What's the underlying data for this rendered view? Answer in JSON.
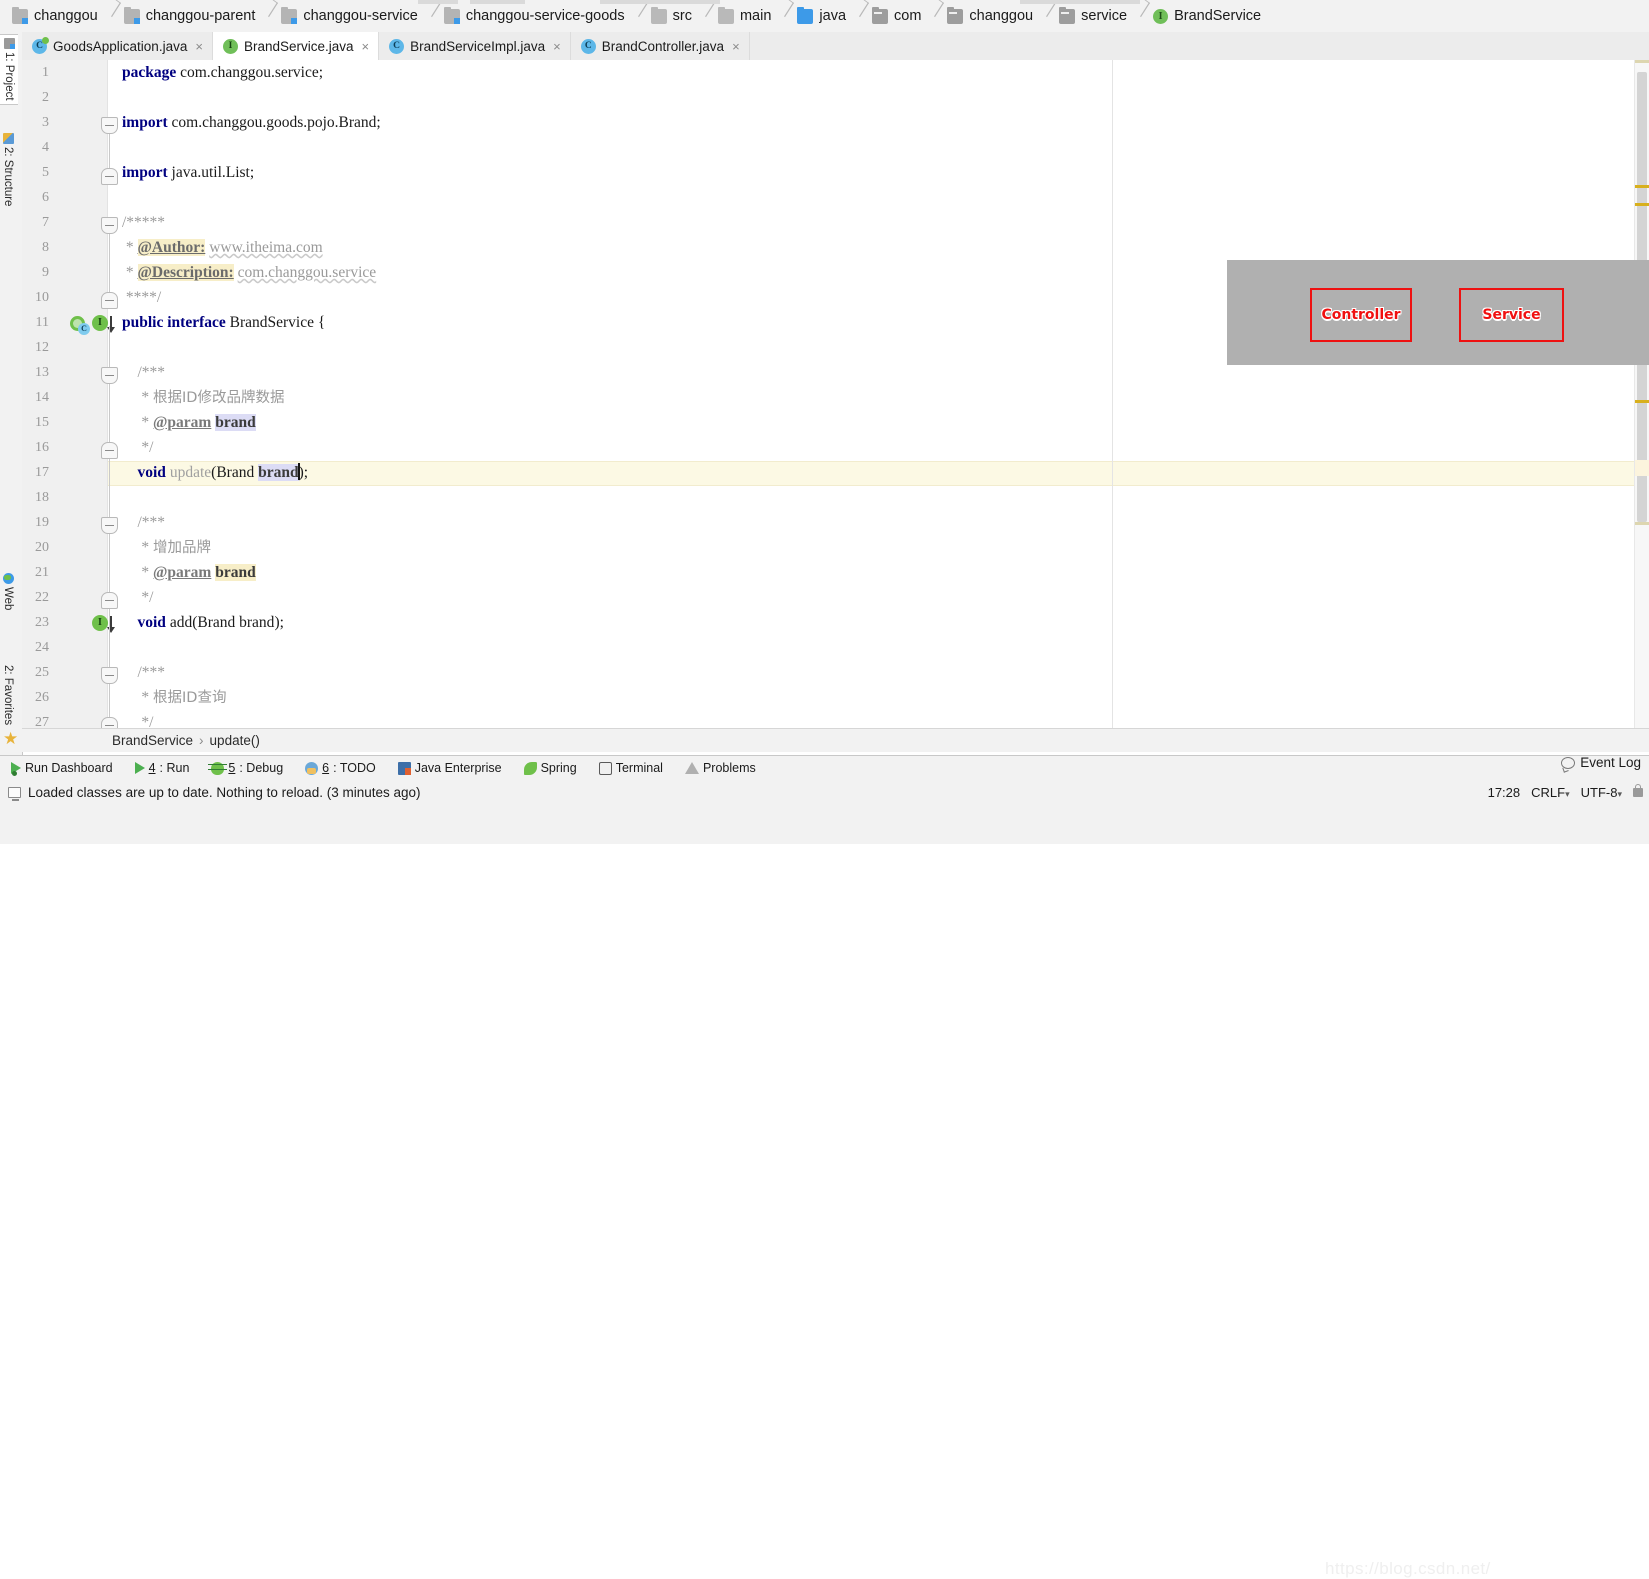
{
  "breadcrumb": {
    "items": [
      {
        "label": "changgou",
        "icon": "module-icon"
      },
      {
        "label": "changgou-parent",
        "icon": "module-icon"
      },
      {
        "label": "changgou-service",
        "icon": "module-icon"
      },
      {
        "label": "changgou-service-goods",
        "icon": "module-icon"
      },
      {
        "label": "src",
        "icon": "folder-icon"
      },
      {
        "label": "main",
        "icon": "folder-icon"
      },
      {
        "label": "java",
        "icon": "source-folder-icon"
      },
      {
        "label": "com",
        "icon": "package-icon"
      },
      {
        "label": "changgou",
        "icon": "package-icon"
      },
      {
        "label": "service",
        "icon": "package-icon"
      },
      {
        "label": "BrandService",
        "icon": "interface-icon"
      }
    ]
  },
  "tool_tabs_left": [
    {
      "label": "1: Project",
      "icon": "project-icon",
      "active": true
    },
    {
      "label": "2: Structure",
      "icon": "structure-icon",
      "active": false
    },
    {
      "label": "Web",
      "icon": "web-icon",
      "active": false
    },
    {
      "label": "2: Favorites",
      "icon": "favorites-icon",
      "active": false
    }
  ],
  "editor_tabs": [
    {
      "label": "GoodsApplication.java",
      "icon": "spring-class-icon",
      "active": false,
      "close": "×"
    },
    {
      "label": "BrandService.java",
      "icon": "interface-icon",
      "active": true,
      "close": "×"
    },
    {
      "label": "BrandServiceImpl.java",
      "icon": "class-icon",
      "active": false,
      "close": "×"
    },
    {
      "label": "BrandController.java",
      "icon": "class-icon",
      "active": false,
      "close": "×"
    }
  ],
  "editor": {
    "caret_line": 17,
    "line_numbers": [
      1,
      2,
      3,
      4,
      5,
      6,
      7,
      8,
      9,
      10,
      11,
      12,
      13,
      14,
      15,
      16,
      17,
      18,
      19,
      20,
      21,
      22,
      23,
      24,
      25,
      26,
      27
    ],
    "lines": [
      {
        "n": 1,
        "text": "package com.changgou.service;"
      },
      {
        "n": 2,
        "text": ""
      },
      {
        "n": 3,
        "text": "import com.changgou.goods.pojo.Brand;"
      },
      {
        "n": 4,
        "text": ""
      },
      {
        "n": 5,
        "text": "import java.util.List;"
      },
      {
        "n": 6,
        "text": ""
      },
      {
        "n": 7,
        "text": "/*****"
      },
      {
        "n": 8,
        "text": " * @Author: www.itheima.com"
      },
      {
        "n": 9,
        "text": " * @Description: com.changgou.service"
      },
      {
        "n": 10,
        "text": " ****/"
      },
      {
        "n": 11,
        "text": "public interface BrandService {"
      },
      {
        "n": 12,
        "text": ""
      },
      {
        "n": 13,
        "text": "    /***"
      },
      {
        "n": 14,
        "text": "     * 根据ID修改品牌数据"
      },
      {
        "n": 15,
        "text": "     * @param brand"
      },
      {
        "n": 16,
        "text": "     */"
      },
      {
        "n": 17,
        "text": "    void update(Brand brand);"
      },
      {
        "n": 18,
        "text": ""
      },
      {
        "n": 19,
        "text": "    /***"
      },
      {
        "n": 20,
        "text": "     * 增加品牌"
      },
      {
        "n": 21,
        "text": "     * @param brand"
      },
      {
        "n": 22,
        "text": "     */"
      },
      {
        "n": 23,
        "text": "    void add(Brand brand);"
      },
      {
        "n": 24,
        "text": ""
      },
      {
        "n": 25,
        "text": "    /***"
      },
      {
        "n": 26,
        "text": "     * 根据ID查询"
      },
      {
        "n": 27,
        "text": "     */"
      }
    ],
    "tokens": {
      "kw_package": "package",
      "kw_import": "import",
      "kw_public": "public",
      "kw_interface": "interface",
      "kw_void": "void",
      "pkg_name": "com.changgou.service;",
      "import1": "com.changgou.goods.pojo.Brand;",
      "import2": "java.util.List;",
      "jd_open5": "/*****",
      "jd_close5": "****/",
      "jd_open3": "/***",
      "jd_close": "*/",
      "star": "*",
      "tag_author": "@Author:",
      "author_value": "www.itheima.com",
      "tag_description": "@Description:",
      "description_value": "com.changgou.service",
      "type_name": "BrandService",
      "brace_open": "{",
      "cjk_update": "根据ID修改品牌数据",
      "cjk_add": "增加品牌",
      "cjk_find": "根据ID查询",
      "tag_param": "@param",
      "param_brand": "brand",
      "m_update": "update",
      "m_add": "add",
      "paren_open": "(",
      "paren_close": ")",
      "semicolon": ";",
      "arg_type": "Brand",
      "arg_name": "brand"
    }
  },
  "breadcrumb_bottom": {
    "class": "BrandService",
    "separator": "›",
    "member": "update()"
  },
  "bottom_tool_window": [
    {
      "label": "Run Dashboard",
      "icon": "run-icon",
      "mnemonic": ""
    },
    {
      "label": ": Run",
      "icon": "play-icon",
      "mnemonic": "4"
    },
    {
      "label": ": Debug",
      "icon": "debug-icon",
      "mnemonic": "5"
    },
    {
      "label": ": TODO",
      "icon": "todo-icon",
      "mnemonic": "6"
    },
    {
      "label": "Java Enterprise",
      "icon": "java-enterprise-icon",
      "mnemonic": ""
    },
    {
      "label": "Spring",
      "icon": "spring-icon",
      "mnemonic": ""
    },
    {
      "label": "Terminal",
      "icon": "terminal-icon",
      "mnemonic": ""
    },
    {
      "label": "Problems",
      "icon": "problems-icon",
      "mnemonic": ""
    }
  ],
  "status": {
    "message": "Loaded classes are up to date. Nothing to reload. (3 minutes ago)",
    "event_log": "Event Log",
    "time": "17:28",
    "line_separator": "CRLF",
    "encoding": "UTF-8",
    "lock_icon": "lock-icon",
    "watermark": "https://blog.csdn.net/"
  },
  "annotation_overlay": {
    "boxes": [
      {
        "label": "Controller"
      },
      {
        "label": "Service"
      }
    ],
    "panel_color": "#b0b0b0",
    "box_border_color": "#ee1111",
    "box_text_color": "#f01010"
  },
  "colors": {
    "keyword": "#000080",
    "comment": "#9a9a9a",
    "caret_line_bg": "#fcf9e4",
    "identifier_highlight": "#dcdcf5",
    "javadoc_tag_highlight": "#f7eec8",
    "accent_green": "#6fc04a",
    "accent_blue": "#3d9ae8"
  }
}
